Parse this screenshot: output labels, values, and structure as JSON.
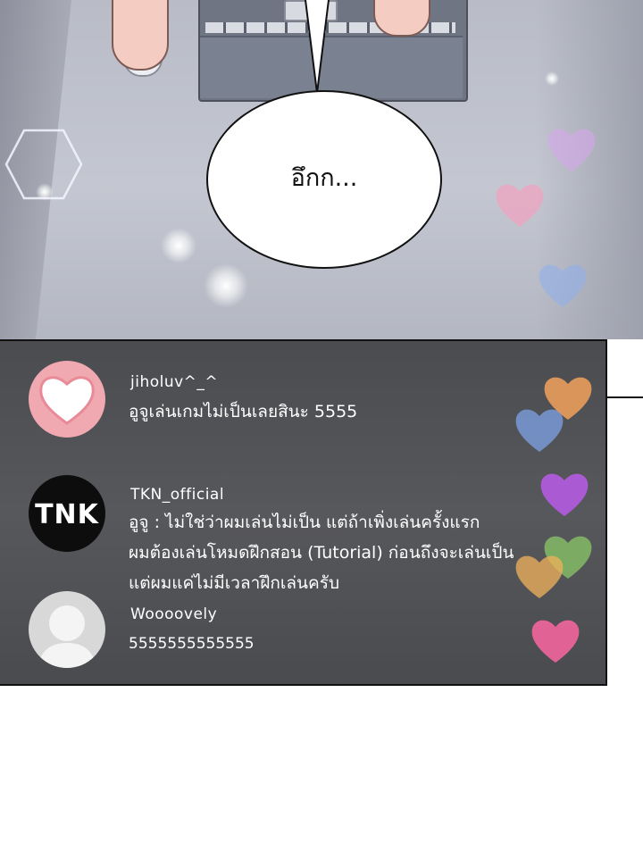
{
  "panel": {
    "speech_bubble_text": "อึกก..."
  },
  "chat": {
    "comments": [
      {
        "username": "jiholuv^_^",
        "avatar_icon": "heart-avatar-icon",
        "lines": [
          "อูจูเล่นเกมไม่เป็นเลยสินะ 5555"
        ]
      },
      {
        "username": "TKN_official",
        "avatar_icon": "tnk-logo-avatar",
        "avatar_text": "TNK",
        "lines": [
          "อูจู : ไม่ใช่ว่าผมเล่นไม่เป็น แต่ถ้าเพิ่งเล่นครั้งแรก",
          "ผมต้องเล่นโหมดฝึกสอน (Tutorial) ก่อนถึงจะเล่นเป็น",
          "แต่ผมแค่ไม่มีเวลาฝึกเล่นครับ"
        ]
      },
      {
        "username": "Woooovely",
        "avatar_icon": "default-user-avatar-icon",
        "lines": [
          "5555555555555"
        ]
      }
    ],
    "reaction_hearts": [
      {
        "color": "#d9a6f0",
        "icon": "heart-icon"
      },
      {
        "color": "#f4a3c0",
        "icon": "heart-icon"
      },
      {
        "color": "#8fb0ef",
        "icon": "heart-icon"
      },
      {
        "color": "#f2a25c",
        "icon": "heart-icon"
      },
      {
        "color": "#7ea3e6",
        "icon": "heart-icon"
      },
      {
        "color": "#b45be0",
        "icon": "heart-icon"
      },
      {
        "color": "#8ed06a",
        "icon": "heart-icon"
      },
      {
        "color": "#f1b25a",
        "icon": "heart-icon"
      },
      {
        "color": "#f2669e",
        "icon": "heart-icon"
      }
    ]
  }
}
